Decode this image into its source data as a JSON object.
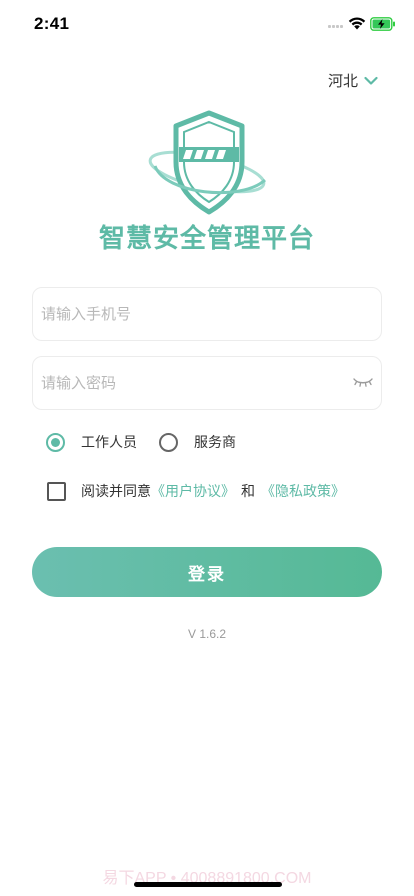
{
  "status_bar": {
    "time": "2:41",
    "icons": [
      "cellular-signal-icon",
      "wifi-icon",
      "battery-charging-icon"
    ]
  },
  "region": {
    "label": "河北",
    "icon": "chevron-down-icon"
  },
  "brand": {
    "logo": "shield-logo",
    "title": "智慧安全管理平台",
    "accent_color": "#5ebaa6"
  },
  "form": {
    "phone_placeholder": "请输入手机号",
    "phone_value": "",
    "password_placeholder": "请输入密码",
    "password_value": "",
    "password_toggle_icon": "eye-closed-icon"
  },
  "roles": {
    "options": [
      {
        "label": "工作人员",
        "selected": true
      },
      {
        "label": "服务商",
        "selected": false
      }
    ]
  },
  "agreement": {
    "checked": false,
    "prefix": "阅读并同意",
    "user_agreement": "《用户协议》",
    "and": "和",
    "privacy_policy": "《隐私政策》"
  },
  "login": {
    "label": "登录"
  },
  "version": "V 1.6.2",
  "watermark": "易下APP • 4008891800.COM"
}
